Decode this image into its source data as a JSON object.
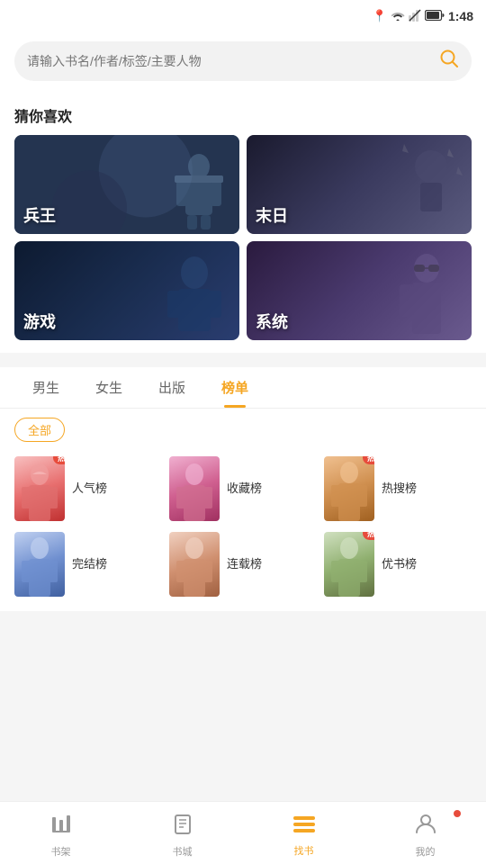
{
  "statusBar": {
    "time": "1:48"
  },
  "search": {
    "placeholder": "请输入书名/作者/标签/主要人物"
  },
  "recommend": {
    "title": "猜你喜欢",
    "cards": [
      {
        "id": "bingwang",
        "label": "兵王",
        "theme": "card-bingwang"
      },
      {
        "id": "moori",
        "label": "末日",
        "theme": "card-moori"
      },
      {
        "id": "youxi",
        "label": "游戏",
        "theme": "card-youxi"
      },
      {
        "id": "xitong",
        "label": "系统",
        "theme": "card-xitong"
      }
    ]
  },
  "tabs": {
    "items": [
      {
        "id": "male",
        "label": "男生"
      },
      {
        "id": "female",
        "label": "女生"
      },
      {
        "id": "publish",
        "label": "出版"
      },
      {
        "id": "rank",
        "label": "榜单"
      }
    ],
    "activeIndex": 3
  },
  "filter": {
    "label": "全部"
  },
  "rankList": {
    "items": [
      {
        "id": "renqi",
        "name": "人气榜",
        "cover": "cover-renqi",
        "hot": true
      },
      {
        "id": "shoucang",
        "name": "收藏榜",
        "cover": "cover-shoucang",
        "hot": false
      },
      {
        "id": "resou",
        "name": "热搜榜",
        "cover": "cover-resou",
        "hot": true
      },
      {
        "id": "wanjie",
        "name": "完结榜",
        "cover": "cover-wanjie",
        "hot": false
      },
      {
        "id": "lianzai",
        "name": "连载榜",
        "cover": "cover-lianzai",
        "hot": false
      },
      {
        "id": "youshu",
        "name": "优书榜",
        "cover": "cover-youshu",
        "hot": true
      }
    ],
    "hotLabel": "热"
  },
  "bottomNav": {
    "items": [
      {
        "id": "bookshelf",
        "label": "书架",
        "icon": "📊"
      },
      {
        "id": "bookstore",
        "label": "书城",
        "icon": "📖"
      },
      {
        "id": "findbbook",
        "label": "找书",
        "icon": "≡",
        "active": true
      },
      {
        "id": "mine",
        "label": "我的",
        "icon": "👤",
        "badge": true
      }
    ]
  }
}
